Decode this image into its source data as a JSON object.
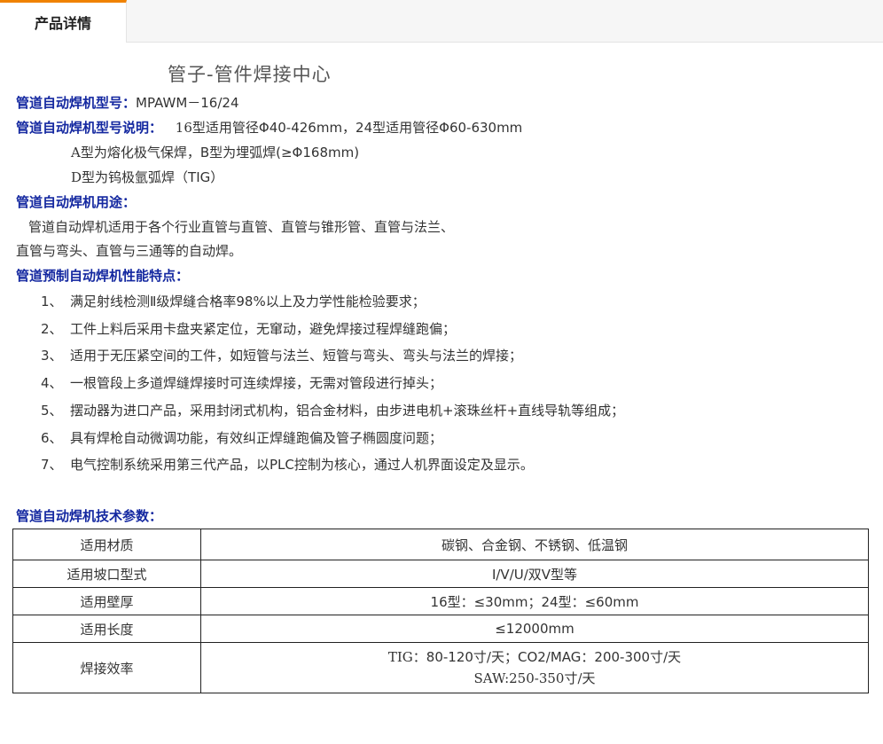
{
  "tab": {
    "label": "产品详情"
  },
  "title": "管子-管件焊接中心",
  "model": {
    "label": "管道自动焊机型号：",
    "value": "MPAWM－16/24"
  },
  "desc": {
    "label": "管道自动焊机型号说明：",
    "line1_prefix": "16",
    "line1_text": "型适用管径Φ40-426mm，24型适用管径Φ60-630mm",
    "line2_prefix": "A",
    "line2_text": "型为熔化极气保焊，B型为埋弧焊(≥Φ168mm)",
    "line3_prefix": "D",
    "line3_text": "型为钨极氩弧焊（TIG）"
  },
  "usage": {
    "label": "管道自动焊机用途：",
    "line1": "管道自动焊机适用于各个行业直管与直管、直管与锥形管、直管与法兰、",
    "line2": "直管与弯头、直管与三通等的自动焊。"
  },
  "features": {
    "label": "管道预制自动焊机性能特点：",
    "items": [
      {
        "num": "1、",
        "text": "满足射线检测Ⅱ级焊缝合格率98%以上及力学性能检验要求；"
      },
      {
        "num": "2、",
        "text": "工件上料后采用卡盘夹紧定位，无窜动，避免焊接过程焊缝跑偏；"
      },
      {
        "num": "3、",
        "text": "适用于无压紧空间的工件，如短管与法兰、短管与弯头、弯头与法兰的焊接；"
      },
      {
        "num": "4、",
        "text": "一根管段上多道焊缝焊接时可连续焊接，无需对管段进行掉头；"
      },
      {
        "num": "5、",
        "text": "摆动器为进口产品，采用封闭式机构，铝合金材料，由步进电机+滚珠丝杆+直线导轨等组成；"
      },
      {
        "num": "6、",
        "text": "具有焊枪自动微调功能，有效纠正焊缝跑偏及管子椭圆度问题；"
      },
      {
        "num": "7、",
        "text": "电气控制系统采用第三代产品，以PLC控制为核心，通过人机界面设定及显示。"
      }
    ]
  },
  "params": {
    "label": "管道自动焊机技术参数：",
    "rows": [
      {
        "key": "适用材质",
        "value": "碳钢、合金钢、不锈钢、低温钢"
      },
      {
        "key": "适用坡口型式",
        "value": "I/V/U/双V型等"
      },
      {
        "key": "适用壁厚",
        "value": "16型：≤30mm；24型：≤60mm"
      },
      {
        "key": "适用长度",
        "value": "≤12000mm"
      },
      {
        "key": "焊接效率",
        "value_prefix": "TIG：",
        "value": "80-120寸/天；CO2/MAG：200-300寸/天",
        "value2": "SAW:250-350寸/天"
      }
    ]
  }
}
